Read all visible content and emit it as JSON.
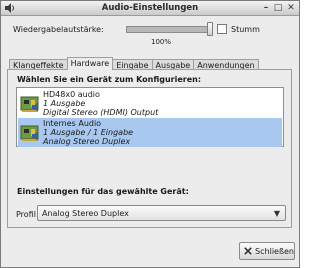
{
  "window": {
    "title": "Audio-Einstellungen"
  },
  "volume": {
    "label": "Wiedergabelautstärke:",
    "level": 1.0,
    "percent_text": "100%",
    "mute_label": "Stumm",
    "mute_checked": false
  },
  "tabs": [
    {
      "label": "Klangeffekte"
    },
    {
      "label": "Hardware",
      "active": true
    },
    {
      "label": "Eingabe"
    },
    {
      "label": "Ausgabe"
    },
    {
      "label": "Anwendungen"
    }
  ],
  "hardware": {
    "choose_label": "Wählen Sie ein Gerät zum Konfigurieren:",
    "devices": [
      {
        "name": "HD48x0 audio",
        "ports": "1 Ausgabe",
        "profile": "Digital Stereo (HDMI) Output",
        "icon": "sound-card-icon",
        "selected": false
      },
      {
        "name": "Internes Audio",
        "ports": "1 Ausgabe / 1 Eingabe",
        "profile": "Analog Stereo Duplex",
        "icon": "sound-card-icon",
        "selected": true
      }
    ],
    "settings_label": "Einstellungen für das gewählte Gerät:",
    "profile_label": "Profil:",
    "profile_value": "Analog Stereo Duplex"
  },
  "footer": {
    "close_label": "Schließen"
  },
  "colors": {
    "selection": "#a9c8ef",
    "slider_fill": "#b8b8b8"
  }
}
